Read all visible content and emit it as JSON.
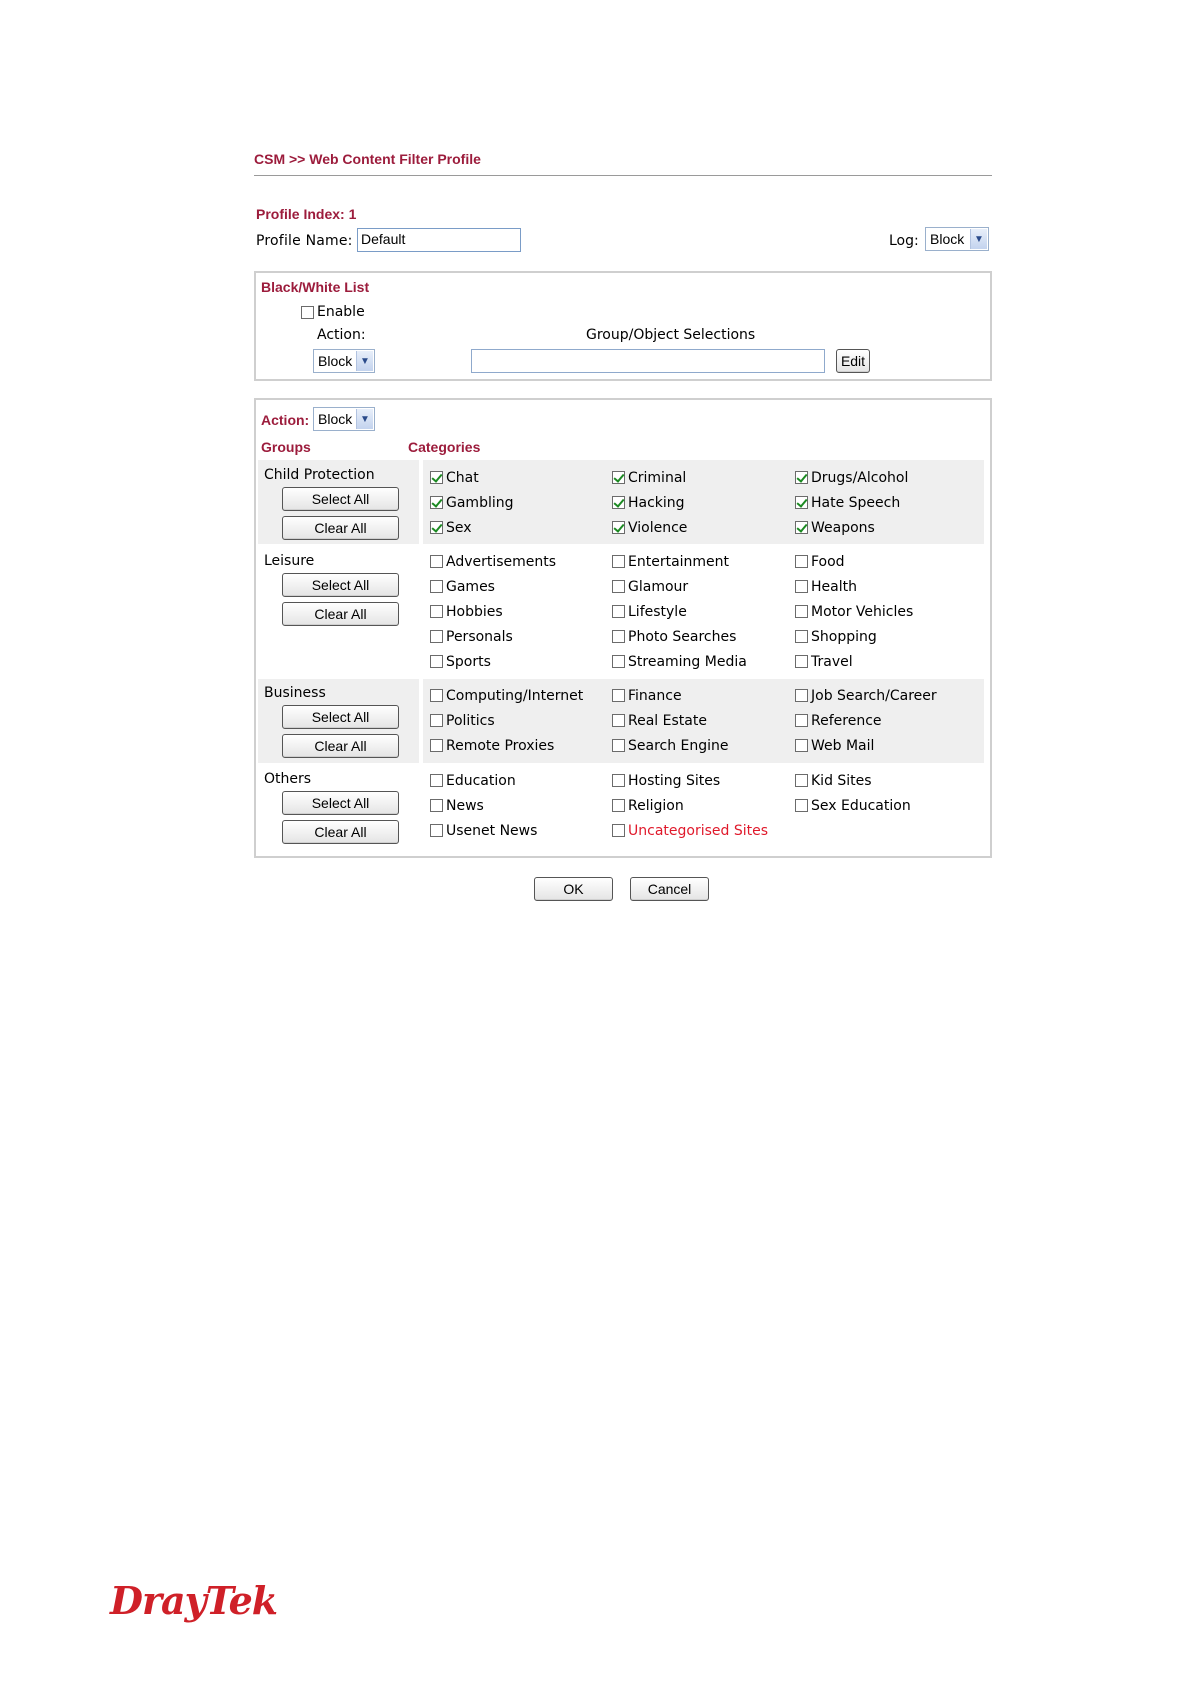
{
  "header": {
    "breadcrumb": "CSM >> Web Content Filter Profile"
  },
  "profile": {
    "index_label": "Profile Index: 1",
    "name_label": "Profile Name:",
    "name_value": "Default",
    "log_label": "Log:",
    "log_value": "Block"
  },
  "blackwhite": {
    "title": "Black/White List",
    "enable_label": "Enable",
    "enable_checked": false,
    "action_label": "Action:",
    "action_value": "Block",
    "group_object_label": "Group/Object Selections",
    "group_object_value": "",
    "edit_label": "Edit"
  },
  "filter": {
    "action_label": "Action:",
    "action_value": "Block",
    "groups_header": "Groups",
    "categories_header": "Categories",
    "select_all_label": "Select All",
    "clear_all_label": "Clear All",
    "groups": [
      {
        "name": "Child Protection",
        "categories": [
          {
            "label": "Chat",
            "checked": true
          },
          {
            "label": "Criminal",
            "checked": true
          },
          {
            "label": "Drugs/Alcohol",
            "checked": true
          },
          {
            "label": "Gambling",
            "checked": true
          },
          {
            "label": "Hacking",
            "checked": true
          },
          {
            "label": "Hate Speech",
            "checked": true
          },
          {
            "label": "Sex",
            "checked": true
          },
          {
            "label": "Violence",
            "checked": true
          },
          {
            "label": "Weapons",
            "checked": true
          }
        ]
      },
      {
        "name": "Leisure",
        "categories": [
          {
            "label": "Advertisements",
            "checked": false
          },
          {
            "label": "Entertainment",
            "checked": false
          },
          {
            "label": "Food",
            "checked": false
          },
          {
            "label": "Games",
            "checked": false
          },
          {
            "label": "Glamour",
            "checked": false
          },
          {
            "label": "Health",
            "checked": false
          },
          {
            "label": "Hobbies",
            "checked": false
          },
          {
            "label": "Lifestyle",
            "checked": false
          },
          {
            "label": "Motor Vehicles",
            "checked": false
          },
          {
            "label": "Personals",
            "checked": false
          },
          {
            "label": "Photo Searches",
            "checked": false
          },
          {
            "label": "Shopping",
            "checked": false
          },
          {
            "label": "Sports",
            "checked": false
          },
          {
            "label": "Streaming Media",
            "checked": false
          },
          {
            "label": "Travel",
            "checked": false
          }
        ]
      },
      {
        "name": "Business",
        "categories": [
          {
            "label": "Computing/Internet",
            "checked": false
          },
          {
            "label": "Finance",
            "checked": false
          },
          {
            "label": "Job Search/Career",
            "checked": false
          },
          {
            "label": "Politics",
            "checked": false
          },
          {
            "label": "Real Estate",
            "checked": false
          },
          {
            "label": "Reference",
            "checked": false
          },
          {
            "label": "Remote Proxies",
            "checked": false
          },
          {
            "label": "Search Engine",
            "checked": false
          },
          {
            "label": "Web Mail",
            "checked": false
          }
        ]
      },
      {
        "name": "Others",
        "categories": [
          {
            "label": "Education",
            "checked": false
          },
          {
            "label": "Hosting Sites",
            "checked": false
          },
          {
            "label": "Kid Sites",
            "checked": false
          },
          {
            "label": "News",
            "checked": false
          },
          {
            "label": "Religion",
            "checked": false
          },
          {
            "label": "Sex Education",
            "checked": false
          },
          {
            "label": "Usenet News",
            "checked": false
          },
          {
            "label": "Uncategorised Sites",
            "checked": false,
            "highlight": "#e0192b"
          }
        ]
      }
    ]
  },
  "footer": {
    "ok_label": "OK",
    "cancel_label": "Cancel"
  },
  "brand": {
    "logo_text": "DrayTek",
    "accent": "#9c1c3c",
    "logo_color": "#cf2028"
  }
}
